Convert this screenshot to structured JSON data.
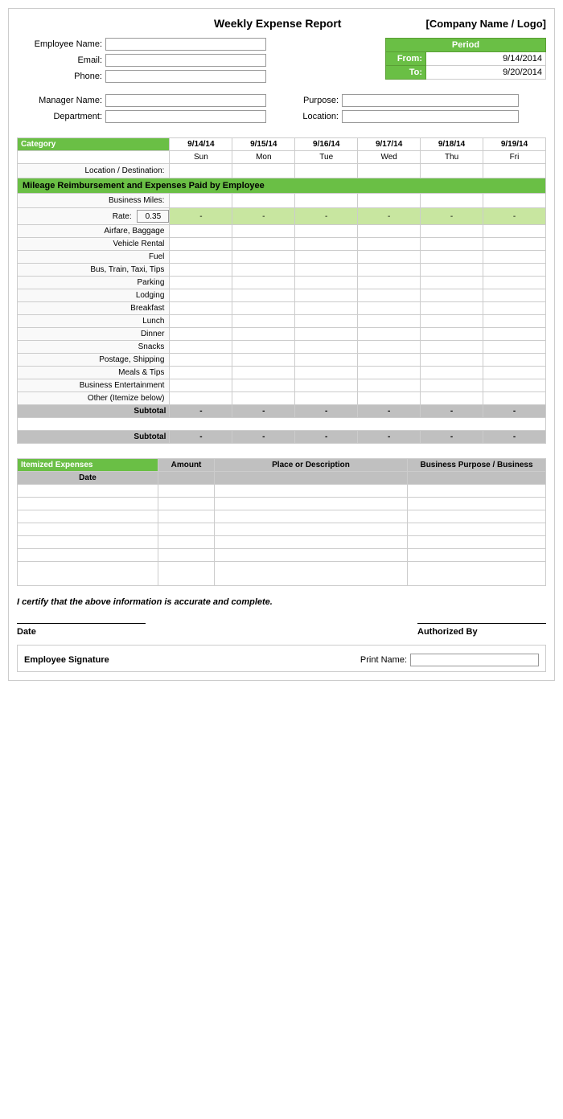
{
  "header": {
    "title": "Weekly Expense Report",
    "company": "[Company Name / Logo]"
  },
  "employee": {
    "name_label": "Employee Name:",
    "email_label": "Email:",
    "phone_label": "Phone:"
  },
  "period": {
    "label": "Period",
    "from_label": "From:",
    "to_label": "To:",
    "from_date": "9/14/2014",
    "to_date": "9/20/2014"
  },
  "manager": {
    "name_label": "Manager Name:",
    "dept_label": "Department:"
  },
  "purpose": {
    "label": "Purpose:",
    "location_label": "Location:"
  },
  "table": {
    "category_label": "Category",
    "dates": [
      "9/14/14",
      "9/15/14",
      "9/16/14",
      "9/17/14",
      "9/18/14",
      "9/19/14"
    ],
    "days": [
      "Sun",
      "Mon",
      "Tue",
      "Wed",
      "Thu",
      "Fri"
    ],
    "location_destination": "Location / Destination:",
    "mileage_header": "Mileage Reimbursement and Expenses Paid by Employee",
    "business_miles_label": "Business Miles:",
    "rate_label": "Rate:",
    "rate_value": "0.35",
    "dash": "-",
    "categories": [
      "Airfare, Baggage",
      "Vehicle Rental",
      "Fuel",
      "Bus, Train, Taxi, Tips",
      "Parking",
      "Lodging",
      "Breakfast",
      "Lunch",
      "Dinner",
      "Snacks",
      "Postage, Shipping",
      "Meals & Tips",
      "Business Entertainment",
      "Other (Itemize below)"
    ],
    "subtotal_label": "Subtotal",
    "subtotal_values": [
      "-",
      "-",
      "-",
      "-",
      "-",
      "-"
    ]
  },
  "second_subtotal": {
    "label": "Subtotal",
    "values": [
      "-",
      "-",
      "-",
      "-",
      "-",
      "-"
    ]
  },
  "itemized": {
    "header": "Itemized Expenses",
    "col_amount": "Amount",
    "col_place": "Place or Description",
    "col_business": "Business Purpose / Business",
    "date_label": "Date",
    "rows": 7
  },
  "certification": {
    "text": "I certify that the above information is accurate and complete."
  },
  "signature": {
    "date_label": "Date",
    "authorized_label": "Authorized By",
    "employee_sig_label": "Employee Signature",
    "print_name_label": "Print Name:"
  }
}
